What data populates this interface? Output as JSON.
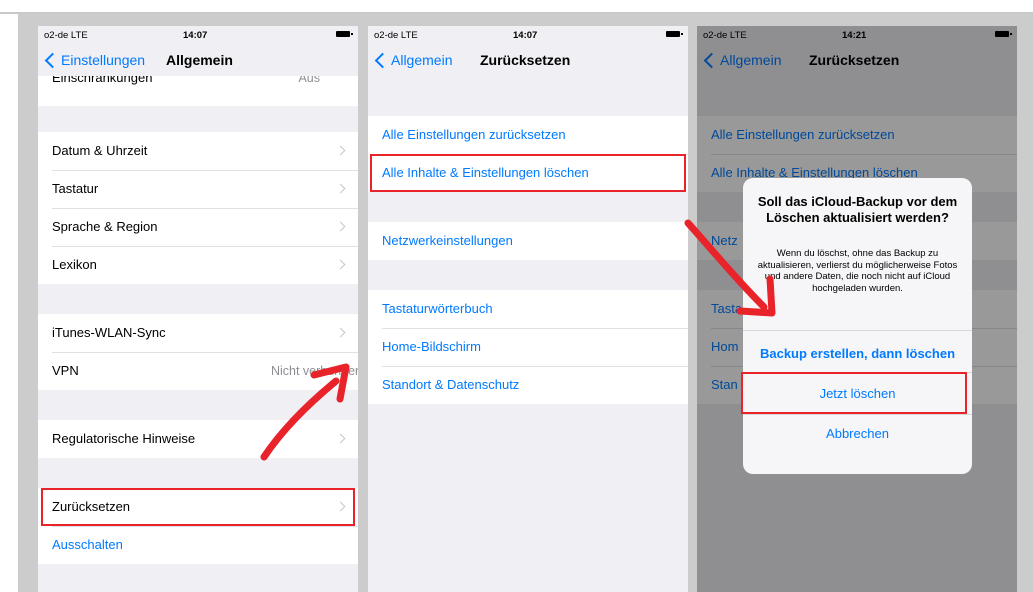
{
  "status": {
    "carrier": "o2-de  LTE",
    "times": [
      "14:07",
      "14:07",
      "14:21"
    ]
  },
  "screen1": {
    "back_label": "Einstellungen",
    "title": "Allgemein",
    "clipped_row": "Einschränkungen",
    "clipped_value": "Aus",
    "rows": [
      {
        "label": "Datum & Uhrzeit"
      },
      {
        "label": "Tastatur"
      },
      {
        "label": "Sprache & Region"
      },
      {
        "label": "Lexikon"
      },
      {
        "label": "iTunes-WLAN-Sync"
      },
      {
        "label": "VPN",
        "value": "Nicht verbunden"
      },
      {
        "label": "Regulatorische Hinweise"
      },
      {
        "label": "Zurücksetzen"
      },
      {
        "label": "Ausschalten"
      }
    ]
  },
  "screen2": {
    "back_label": "Allgemein",
    "title": "Zurücksetzen",
    "rows": [
      "Alle Einstellungen zurücksetzen",
      "Alle Inhalte & Einstellungen löschen",
      "Netzwerkeinstellungen",
      "Tastaturwörterbuch",
      "Home-Bildschirm",
      "Standort & Datenschutz"
    ]
  },
  "screen3": {
    "back_label": "Allgemein",
    "title": "Zurücksetzen",
    "bg_rows": [
      "Alle Einstellungen zurücksetzen",
      "Alle Inhalte & Einstellungen löschen",
      "Netz",
      "Tasta",
      "Hom",
      "Stan"
    ],
    "alert": {
      "title": "Soll das iCloud-Backup vor dem Löschen aktualisiert werden?",
      "message": "Wenn du löschst, ohne das Backup zu aktualisieren, verlierst du möglicherweise Fotos und andere Daten, die noch nicht auf iCloud hochgeladen wurden.",
      "buttons": [
        "Backup erstellen, dann löschen",
        "Jetzt löschen",
        "Abbrechen"
      ]
    }
  },
  "colors": {
    "accent": "#007aff",
    "highlight": "#e8232a",
    "arrow": "#e8232a"
  }
}
